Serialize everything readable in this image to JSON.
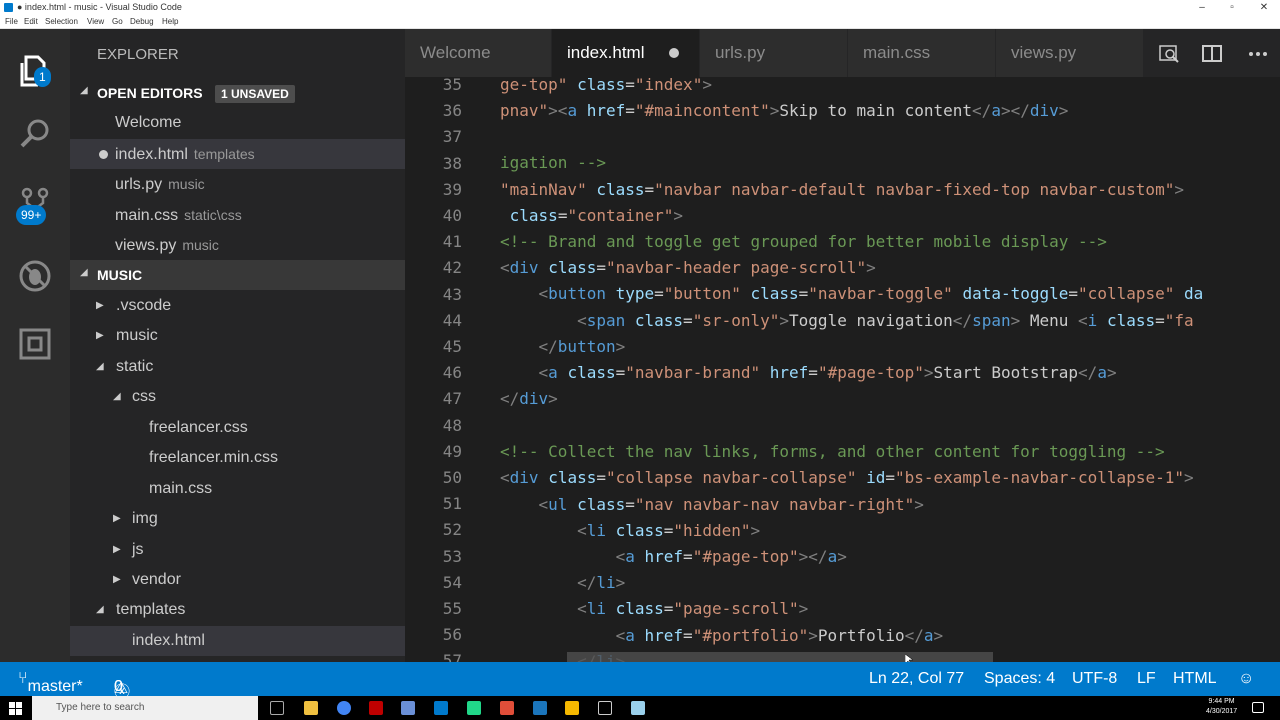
{
  "window": {
    "title": "● index.html - music - Visual Studio Code",
    "minimize": "–",
    "maximize": "▫",
    "close": "✕"
  },
  "menu": [
    "File",
    "Edit",
    "Selection",
    "View",
    "Go",
    "Debug",
    "Help"
  ],
  "activity_bar": {
    "explorer_badge": "1",
    "scm_badge": "99+"
  },
  "sidebar": {
    "title": "EXPLORER",
    "open_editors": {
      "label": "OPEN EDITORS",
      "unsaved": "1 UNSAVED",
      "items": [
        {
          "name": "Welcome",
          "hint": ""
        },
        {
          "name": "index.html",
          "hint": "templates"
        },
        {
          "name": "urls.py",
          "hint": "music"
        },
        {
          "name": "main.css",
          "hint": "static\\css"
        },
        {
          "name": "views.py",
          "hint": "music"
        }
      ]
    },
    "project": {
      "label": "MUSIC",
      "tree": [
        ".vscode",
        "music",
        "static",
        "css",
        "freelancer.css",
        "freelancer.min.css",
        "main.css",
        "img",
        "js",
        "vendor",
        "templates",
        "index.html"
      ]
    }
  },
  "tabs": [
    "Welcome",
    "index.html",
    "urls.py",
    "main.css",
    "views.py"
  ],
  "editor": {
    "line_numbers": [
      "35",
      "36",
      "37",
      "38",
      "39",
      "40",
      "41",
      "42",
      "43",
      "44",
      "45",
      "46",
      "47",
      "48",
      "49",
      "50",
      "51",
      "52",
      "53",
      "54",
      "55",
      "56",
      "57"
    ]
  },
  "status": {
    "branch": "master*",
    "errors": "0",
    "warnings": "0",
    "position": "Ln 22, Col 77",
    "spaces": "Spaces: 4",
    "encoding": "UTF-8",
    "eol": "LF",
    "language": "HTML"
  },
  "taskbar": {
    "search_placeholder": "Type here to search",
    "time": "9:44 PM",
    "date": "4/30/2017"
  },
  "colors": {
    "accent": "#007acc",
    "sidebar": "#252526",
    "editor": "#1e1e1e",
    "activity": "#2c2c2c"
  }
}
